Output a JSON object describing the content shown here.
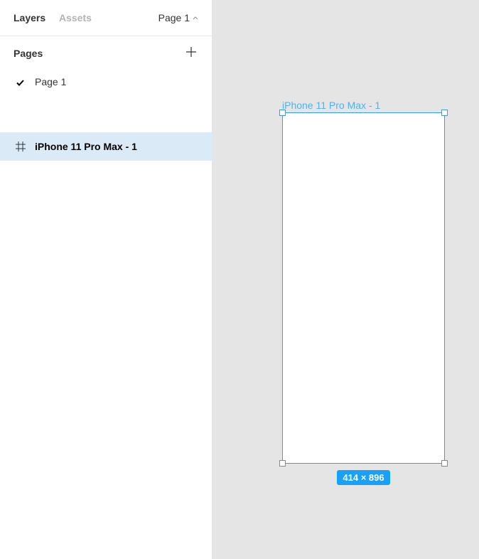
{
  "tabs": {
    "layers": "Layers",
    "assets": "Assets"
  },
  "page_switcher": {
    "label": "Page 1",
    "icon": "chevron-up-icon"
  },
  "pages": {
    "header": "Pages",
    "add_icon": "plus-icon",
    "items": [
      {
        "label": "Page 1",
        "selected": true,
        "icon": "checkmark-icon"
      }
    ]
  },
  "layers": [
    {
      "label": "iPhone 11 Pro Max - 1",
      "icon": "frame-icon",
      "selected": true
    }
  ],
  "canvas": {
    "frame_label": "iPhone 11 Pro Max - 1",
    "size_badge": "414 × 896"
  },
  "colors": {
    "selection": "#18a0fb",
    "layer_highlight": "#daebf7",
    "canvas_bg": "#e5e5e5"
  }
}
